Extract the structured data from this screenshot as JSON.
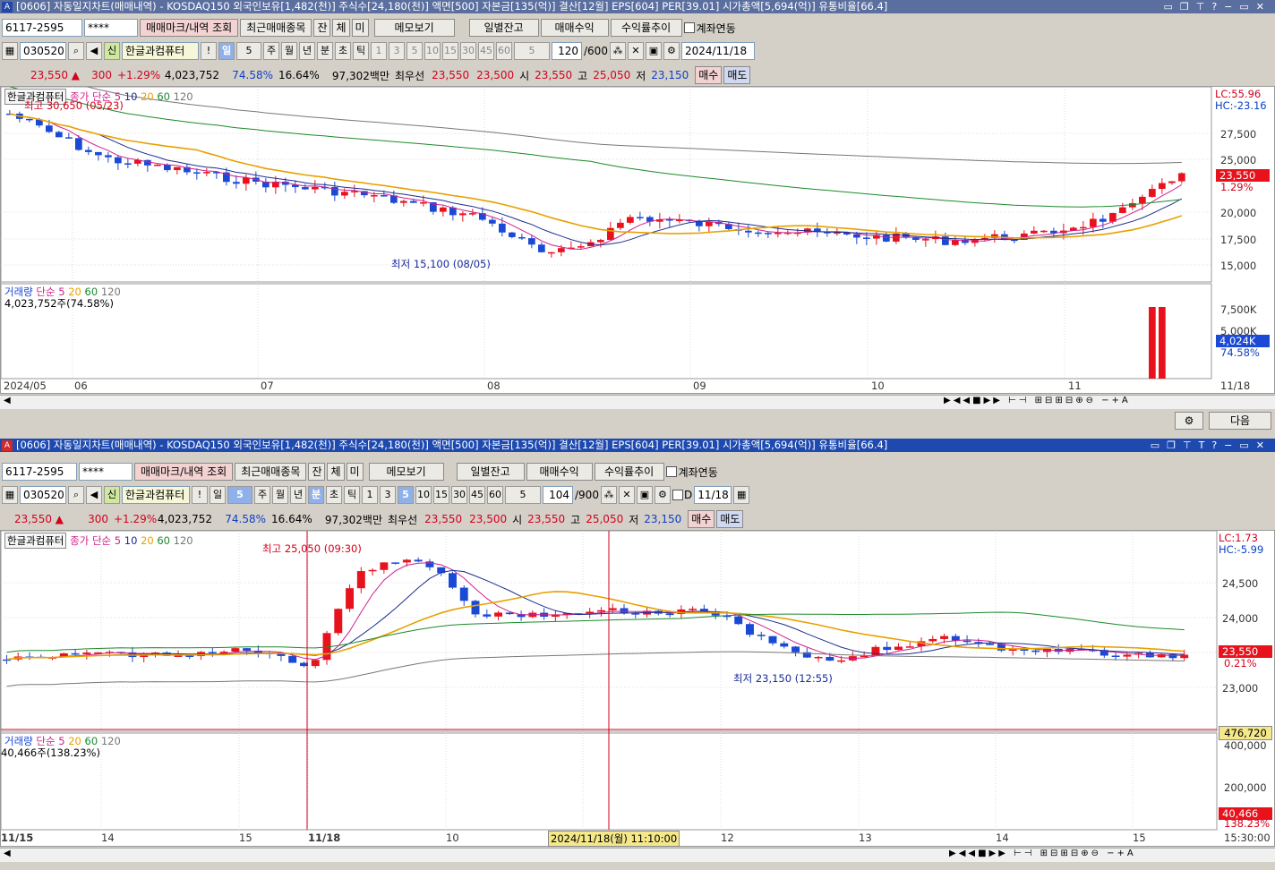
{
  "top": {
    "title": "[0606] 자동일지차트(매매내역) - KOSDAQ150 외국인보유[1,482(천)] 주식수[24,180(천)] 액면[500] 자본금[135(억)] 결산[12월] EPS[604] PER[39.01] 시가총액[5,694(억)] 유통비율[66.4]",
    "account": "6117-2595",
    "password": "****",
    "btn_trade_mark": "매매마크/내역 조회",
    "btn_recent": "최근매매종목",
    "btn_jan": "잔",
    "btn_che": "체",
    "btn_mi": "미",
    "btn_memo": "메모보기",
    "btn_daily": "일별잔고",
    "btn_profit": "매매수익",
    "btn_return": "수익률추이",
    "chk_link": "계좌연동",
    "code": "030520",
    "sin": "신",
    "stock_name": "한글과컴퓨터",
    "excl": "!",
    "period": "일",
    "period_n": "5",
    "p_week": "주",
    "p_month": "월",
    "p_year": "년",
    "p_min": "분",
    "p_sec": "초",
    "p_tick": "틱",
    "n1": "1",
    "n3": "3",
    "n5": "5",
    "n10": "10",
    "n15": "15",
    "n30": "30",
    "n45": "45",
    "n60": "60",
    "sel_n": "5",
    "count": "120",
    "count_max": "/600",
    "date": "2024/11/18",
    "q_price": "23,550 ▲",
    "q_change": "300",
    "q_rate": "+1.29%",
    "q_volume": "4,023,752",
    "q_vrate": "74.58%",
    "q_turn": "16.64%",
    "q_amount": "97,302백만",
    "q_best": "최우선",
    "q_ask": "23,550",
    "q_bid": "23,500",
    "q_open_l": "시",
    "q_open": "23,550",
    "q_high_l": "고",
    "q_high": "25,050",
    "q_low_l": "저",
    "q_low": "23,150",
    "buy": "매수",
    "sell": "매도",
    "legend_stock": "한글과컴퓨터",
    "legend_ma": "종가 단순",
    "ma5": "5",
    "ma10": "10",
    "ma20": "20",
    "ma60": "60",
    "ma120": "120",
    "high_label": "최고 30,650 (05/23)",
    "low_label": "최저 15,100 (08/05)",
    "lc": "LC:55.96",
    "hc": "HC:-23.16",
    "price_ticks": [
      "27,500",
      "25,000",
      "22,500",
      "20,000",
      "17,500",
      "15,000"
    ],
    "cur_price_box": "23,550",
    "cur_rate": "1.29%",
    "vol_legend": "거래량",
    "vol_ma": "단순",
    "vol_ma5": "5",
    "vol_ma20": "20",
    "vol_ma60": "60",
    "vol_ma120": "120",
    "vol_value": "4,023,752주(74.58%)",
    "vol_ticks": [
      "7,500K",
      "5,000K"
    ],
    "vol_box": "4,024K",
    "vol_rate": "74.58%",
    "x_labels": [
      "2024/05",
      "06",
      "07",
      "08",
      "09",
      "10",
      "11"
    ],
    "x_last": "11/18",
    "next_btn": "다음"
  },
  "bottom": {
    "title": "[0606] 자동일지차트(매매내역) - KOSDAQ150 외국인보유[1,482(천)] 주식수[24,180(천)] 액면[500] 자본금[135(억)] 결산[12월] EPS[604] PER[39.01] 시가총액[5,694(억)] 유통비율[66.4]",
    "account": "6117-2595",
    "password": "****",
    "btn_trade_mark": "매매마크/내역 조회",
    "btn_recent": "최근매매종목",
    "btn_jan": "잔",
    "btn_che": "체",
    "btn_mi": "미",
    "btn_memo": "메모보기",
    "btn_daily": "일별잔고",
    "btn_profit": "매매수익",
    "btn_return": "수익률추이",
    "chk_link": "계좌연동",
    "code": "030520",
    "sin": "신",
    "stock_name": "한글과컴퓨터",
    "excl": "!",
    "period": "일",
    "period_n": "5",
    "p_week": "주",
    "p_month": "월",
    "p_year": "년",
    "p_min": "분",
    "p_sec": "초",
    "p_tick": "틱",
    "n1": "1",
    "n3": "3",
    "n5": "5",
    "n10": "10",
    "n15": "15",
    "n30": "30",
    "n45": "45",
    "n60": "60",
    "sel_n": "5",
    "count": "104",
    "count_max": "/900",
    "chk_d": "D",
    "date": "11/18",
    "q_price": "23,550 ▲",
    "q_change": "300",
    "q_rate": "+1.29%",
    "q_volume": "4,023,752",
    "q_vrate": "74.58%",
    "q_turn": "16.64%",
    "q_amount": "97,302백만",
    "q_best": "최우선",
    "q_ask": "23,550",
    "q_bid": "23,500",
    "q_open_l": "시",
    "q_open": "23,550",
    "q_high_l": "고",
    "q_high": "25,050",
    "q_low_l": "저",
    "q_low": "23,150",
    "buy": "매수",
    "sell": "매도",
    "legend_stock": "한글과컴퓨터",
    "legend_ma": "종가 단순",
    "ma5": "5",
    "ma10": "10",
    "ma20": "20",
    "ma60": "60",
    "ma120": "120",
    "high_label": "최고 25,050 (09:30)",
    "low_label": "최저 23,150 (12:55)",
    "lc": "LC:1.73",
    "hc": "HC:-5.99",
    "price_ticks": [
      "24,500",
      "24,000",
      "23,500",
      "23,000"
    ],
    "cur_price_box": "23,550",
    "cur_rate": "0.21%",
    "cross_box": "476,720",
    "vol_legend": "거래량",
    "vol_ma": "단순",
    "vol_ma5": "5",
    "vol_ma20": "20",
    "vol_ma60": "60",
    "vol_ma120": "120",
    "vol_value": "40,466주(138.23%)",
    "vol_ticks": [
      "400,000",
      "200,000"
    ],
    "vol_box": "40,466",
    "vol_rate": "138.23%",
    "x_labels": [
      "11/15",
      "14",
      "15",
      "11/18",
      "10",
      "11",
      "12",
      "13",
      "14",
      "15"
    ],
    "cross_time": "2024/11/18(월) 11:10:00",
    "x_last": "15:30:00"
  },
  "colors": {
    "up": "#e8121c",
    "down": "#1a49d6",
    "ma5": "#d0208c",
    "ma10": "#1c2e8c",
    "ma20": "#e8a000",
    "ma60": "#1a8a2a",
    "ma120": "#777777"
  }
}
